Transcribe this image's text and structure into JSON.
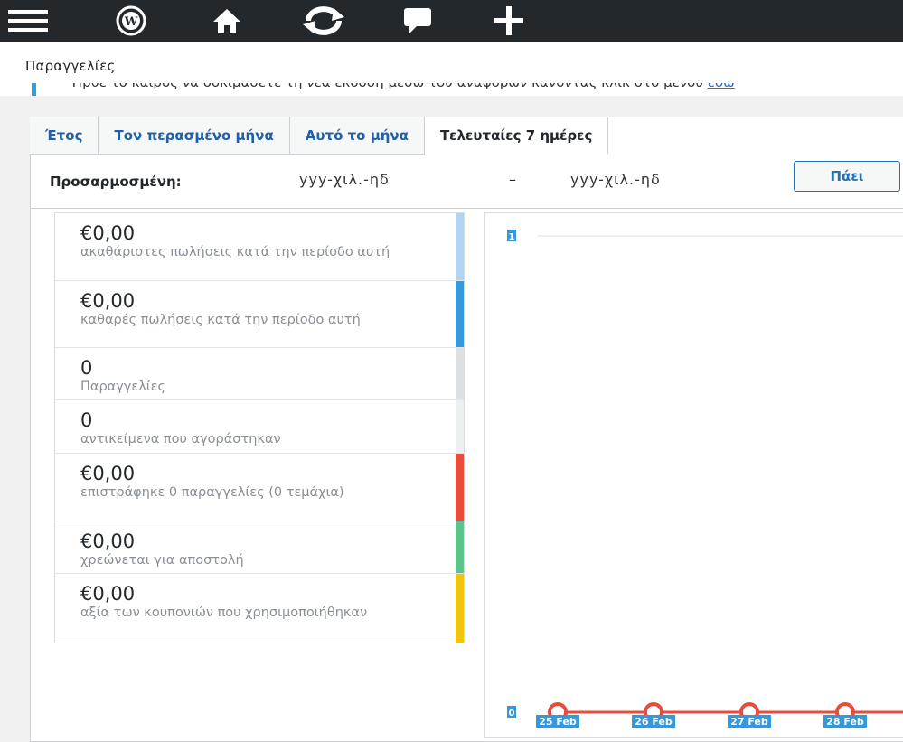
{
  "topbar": {
    "icons": [
      "menu-icon",
      "wordpress-icon",
      "home-icon",
      "refresh-icon",
      "comment-icon",
      "plus-icon"
    ]
  },
  "page": {
    "title": "Παραγγελίες",
    "notice_text": "Ήρθε το καιρός να δοκιμάσετε τη νέα έκδοση μέσω του αναφορών κάνοντας κλικ στο μενού ",
    "notice_link": "εδώ"
  },
  "tabs": [
    "Έτος",
    "Τον περασμένο μήνα",
    "Αυτό το μήνα",
    "Τελευταίες 7 ημέρες"
  ],
  "custom_range": {
    "label": "Προσαρμοσμένη:",
    "from_placeholder": "yyy-χιλ.-ηδ",
    "dash": "–",
    "to_placeholder": "yyy-χιλ.-ηδ",
    "go_label": "Πάει"
  },
  "summary": [
    {
      "value": "€0,00",
      "label": "ακαθάριστες πωλήσεις κατά την περίοδο αυτή",
      "color": "#b3d4f0"
    },
    {
      "value": "€0,00",
      "label": "καθαρές πωλήσεις κατά την περίοδο αυτή",
      "color": "#3498db"
    },
    {
      "value": "0",
      "label": "Παραγγελίες",
      "color": "#dbe1e3"
    },
    {
      "value": "0",
      "label": "αντικείμενα που αγοράστηκαν",
      "color": "#ecf0f1"
    },
    {
      "value": "€0,00",
      "label": "επιστράφηκε 0 παραγγελίες (0 τεμάχια)",
      "color": "#e74c3c"
    },
    {
      "value": "€0,00",
      "label": "χρεώνεται για αποστολή",
      "color": "#5cc488"
    },
    {
      "value": "€0,00",
      "label": "αξία των κουπονιών που χρησιμοποιήθηκαν",
      "color": "#f1c40f"
    }
  ],
  "chart_data": {
    "type": "line",
    "x": [
      "25 Feb",
      "26 Feb",
      "27 Feb",
      "28 Feb"
    ],
    "series": [
      {
        "values": [
          0,
          0,
          0,
          0
        ],
        "color": "#e74c3c"
      }
    ],
    "ytick_labels": [
      "0",
      "1"
    ],
    "ylim": [
      0,
      1
    ],
    "grid": true,
    "label_color": "#3498db"
  }
}
